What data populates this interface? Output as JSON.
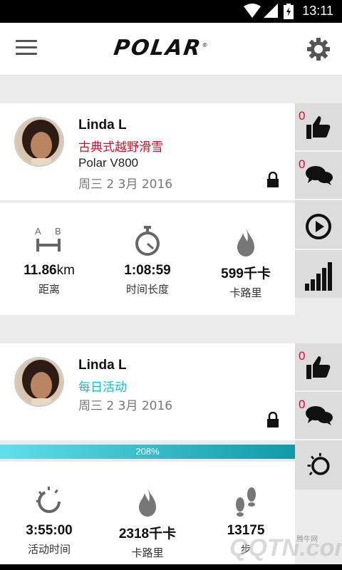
{
  "status_bar": {
    "time": "13:11"
  },
  "app_bar": {
    "logo": "POLAR",
    "logo_mark": "®"
  },
  "feed": [
    {
      "user": "Linda L",
      "sport": "古典式越野滑雪",
      "sport_color": "#d0102a",
      "device": "Polar V800",
      "date": "周三 2 3月 2016",
      "likes": "0",
      "comments": "0",
      "stats": [
        {
          "value": "11.86",
          "unit": "km",
          "label": "距离",
          "icon": "distance-ab-icon"
        },
        {
          "value": "1:08:59",
          "unit": "",
          "label": "时间长度",
          "icon": "stopwatch-icon"
        },
        {
          "value": "599千卡",
          "unit": "",
          "label": "卡路里",
          "icon": "flame-icon"
        }
      ]
    },
    {
      "user": "Linda L",
      "sport": "每日活动",
      "sport_color": "#1fb8cf",
      "date": "周三 2 3月 2016",
      "likes": "0",
      "comments": "0",
      "progress_label": "208%",
      "progress_value": 2.08,
      "stats": [
        {
          "value": "3:55:00",
          "label": "活动时间",
          "icon": "activity-ring-icon"
        },
        {
          "value": "2318千卡",
          "label": "卡路里",
          "icon": "flame-icon"
        },
        {
          "value": "13175",
          "label": "步",
          "icon": "footsteps-icon"
        }
      ]
    }
  ],
  "watermark": {
    "text": "QQTN.com",
    "small": "腾牛网"
  }
}
